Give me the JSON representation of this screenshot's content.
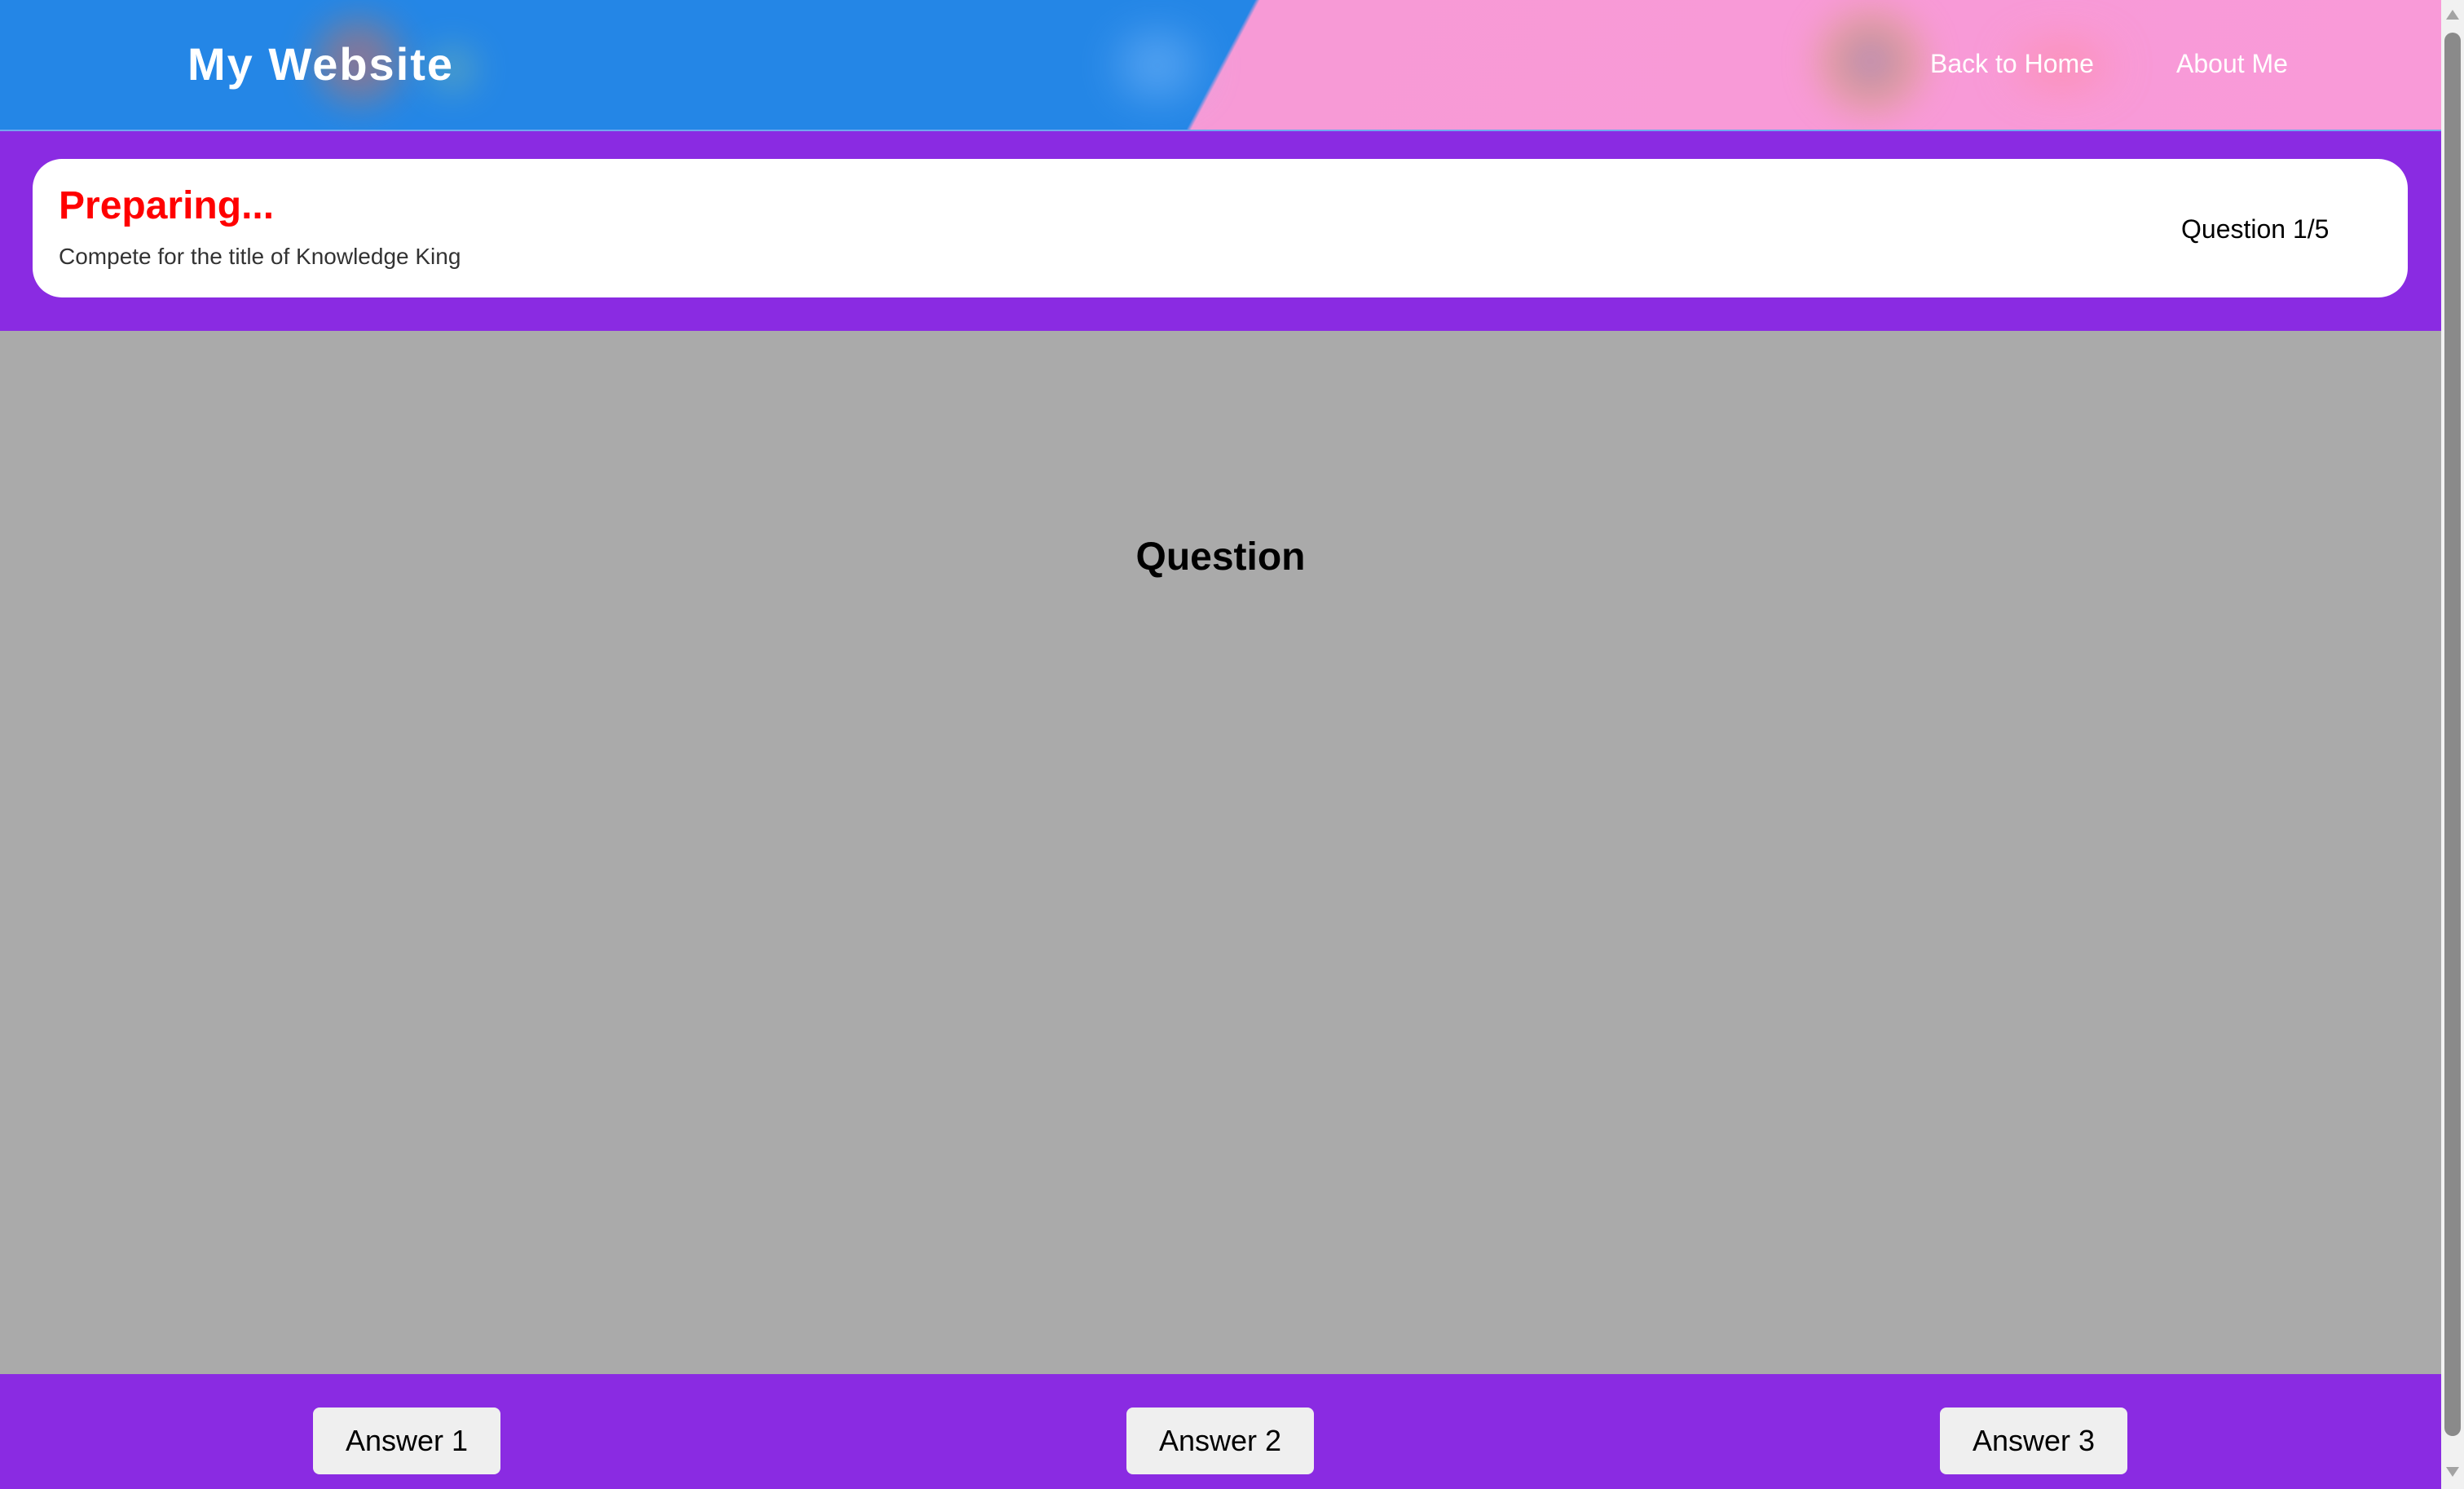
{
  "header": {
    "site_title": "My Website",
    "nav": {
      "home_label": "Back to Home",
      "about_label": "About Me"
    }
  },
  "status": {
    "title": "Preparing...",
    "subtitle": "Compete for the title of Knowledge King",
    "counter": "Question 1/5"
  },
  "question": {
    "text": "Question"
  },
  "answers": [
    {
      "label": "Answer 1"
    },
    {
      "label": "Answer 2"
    },
    {
      "label": "Answer 3"
    }
  ],
  "colors": {
    "header_blue": "#2486e6",
    "header_pink": "#f99ad8",
    "band_purple": "#8a2be2",
    "status_title_red": "#ff0000",
    "question_area_gray": "#aaaaaa"
  }
}
